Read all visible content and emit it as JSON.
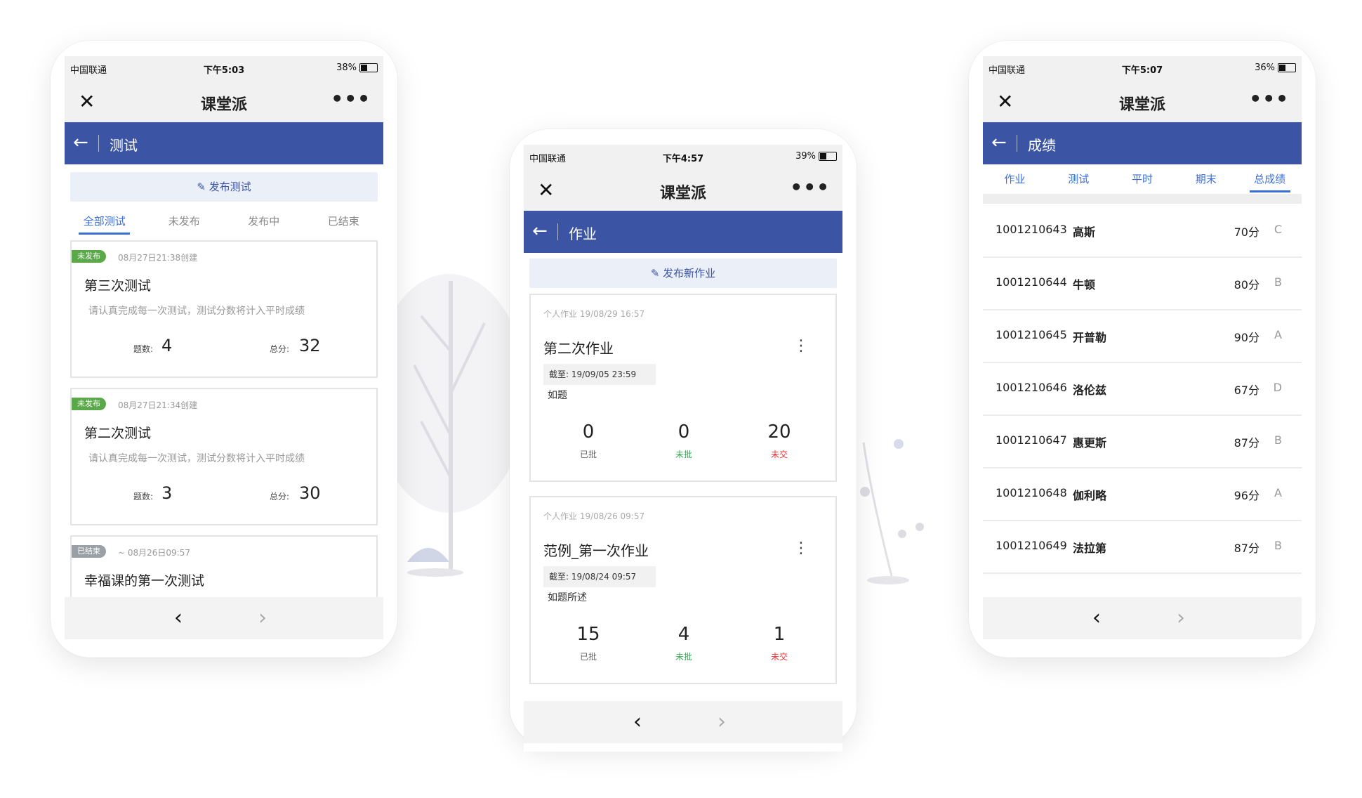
{
  "left_phone": {
    "status": {
      "carrier": "中国联通",
      "time": "下午5:03",
      "battery": "38%"
    },
    "title": "课堂派",
    "nav_title": "测试",
    "publish_label": "发布测试",
    "tabs": [
      "全部测试",
      "未发布",
      "发布中",
      "已结束"
    ],
    "cards": [
      {
        "badge": "未发布",
        "created": "08月27日21:38创建",
        "title": "第三次测试",
        "desc": "请认真完成每一次测试，测试分数将计入平时成绩",
        "q_label": "题数:",
        "q_val": "4",
        "s_label": "总分:",
        "s_val": "32"
      },
      {
        "badge": "未发布",
        "created": "08月27日21:34创建",
        "title": "第二次测试",
        "desc": "请认真完成每一次测试，测试分数将计入平时成绩",
        "q_label": "题数:",
        "q_val": "3",
        "s_label": "总分:",
        "s_val": "30"
      },
      {
        "badge": "已结束",
        "created": "~ 08月26日09:57",
        "title": "幸福课的第一次测试"
      }
    ]
  },
  "mid_phone": {
    "status": {
      "carrier": "中国联通",
      "time": "下午4:57",
      "battery": "39%"
    },
    "title": "课堂派",
    "nav_title": "作业",
    "publish_label": "发布新作业",
    "homeworks": [
      {
        "meta": "个人作业  19/08/29 16:57",
        "title": "第二次作业",
        "deadline": "截至: 19/09/05 23:59",
        "desc": "如题",
        "graded": "0",
        "ungraded": "0",
        "unsubmitted": "20"
      },
      {
        "meta": "个人作业  19/08/26 09:57",
        "title": "范例_第一次作业",
        "deadline": "截至: 19/08/24 09:57",
        "desc": "如题所述",
        "graded": "15",
        "ungraded": "4",
        "unsubmitted": "1"
      }
    ],
    "labels": {
      "graded": "已批",
      "ungraded": "未批",
      "unsubmitted": "未交"
    }
  },
  "right_phone": {
    "status": {
      "carrier": "中国联通",
      "time": "下午5:07",
      "battery": "36%"
    },
    "title": "课堂派",
    "nav_title": "成绩",
    "tabs": [
      "作业",
      "测试",
      "平时",
      "期末",
      "总成绩"
    ],
    "rows": [
      {
        "id": "1001210643",
        "name": "高斯",
        "score": "70分",
        "grade": "C"
      },
      {
        "id": "1001210644",
        "name": "牛顿",
        "score": "80分",
        "grade": "B"
      },
      {
        "id": "1001210645",
        "name": "开普勒",
        "score": "90分",
        "grade": "A"
      },
      {
        "id": "1001210646",
        "name": "洛伦兹",
        "score": "67分",
        "grade": "D"
      },
      {
        "id": "1001210647",
        "name": "惠更斯",
        "score": "87分",
        "grade": "B"
      },
      {
        "id": "1001210648",
        "name": "伽利略",
        "score": "96分",
        "grade": "A"
      },
      {
        "id": "1001210649",
        "name": "法拉第",
        "score": "87分",
        "grade": "B"
      }
    ]
  },
  "colors": {
    "nav_blue": "#3b55a4",
    "tab_blue": "#3b6fd8",
    "green": "#3aa85a",
    "red": "#e33333"
  }
}
